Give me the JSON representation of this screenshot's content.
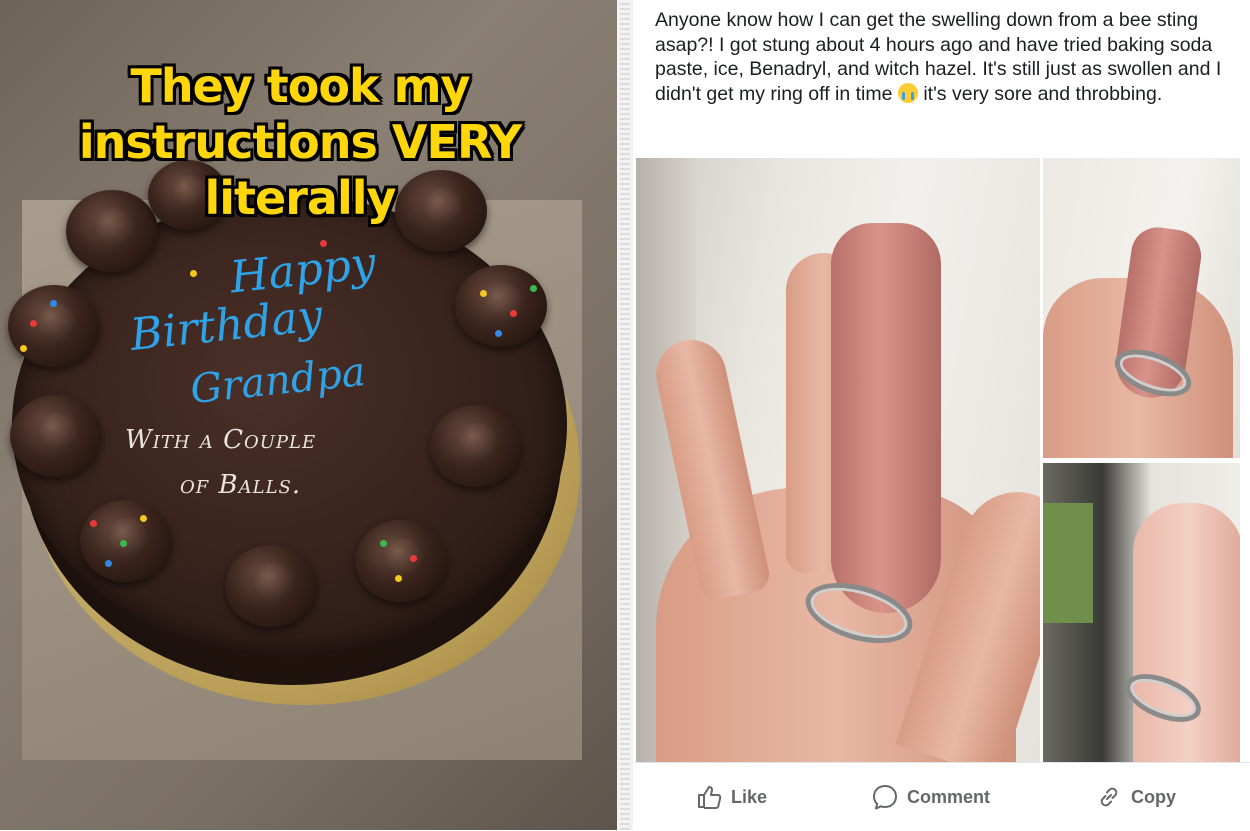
{
  "left_panel": {
    "caption": [
      "They took my",
      "instructions VERY",
      "literally"
    ],
    "cake_text": {
      "line1": "Happy",
      "line2": "Birthday",
      "line3": "Grandpa",
      "line4": "With a Couple",
      "line5": "of Balls."
    }
  },
  "right_panel": {
    "post_text_before_emoji": "Anyone know how I can get the swelling down from a bee sting asap?! I got stung about 4 hours ago and have tried baking soda paste, ice, Benadryl, and witch hazel. It's still just as swollen and I didn't get my ring off in time",
    "post_text_after_emoji": "it's very sore and throbbing.",
    "emoji": "crying-face-emoji",
    "actions": {
      "like": "Like",
      "comment": "Comment",
      "copy": "Copy"
    }
  },
  "colors": {
    "caption_yellow": "#ffd60a",
    "icing_blue": "#2fa3e8",
    "fb_action_gray": "#65676b",
    "text_dark": "#1c1e21"
  }
}
